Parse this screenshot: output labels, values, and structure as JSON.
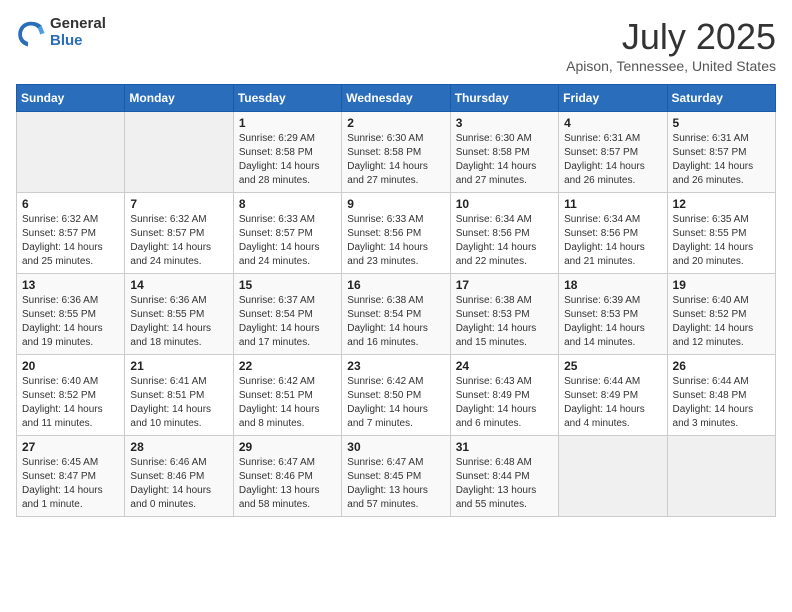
{
  "header": {
    "logo_general": "General",
    "logo_blue": "Blue",
    "month": "July 2025",
    "location": "Apison, Tennessee, United States"
  },
  "days_of_week": [
    "Sunday",
    "Monday",
    "Tuesday",
    "Wednesday",
    "Thursday",
    "Friday",
    "Saturday"
  ],
  "weeks": [
    [
      {
        "day": "",
        "sunrise": "",
        "sunset": "",
        "daylight": ""
      },
      {
        "day": "",
        "sunrise": "",
        "sunset": "",
        "daylight": ""
      },
      {
        "day": "1",
        "sunrise": "Sunrise: 6:29 AM",
        "sunset": "Sunset: 8:58 PM",
        "daylight": "Daylight: 14 hours and 28 minutes."
      },
      {
        "day": "2",
        "sunrise": "Sunrise: 6:30 AM",
        "sunset": "Sunset: 8:58 PM",
        "daylight": "Daylight: 14 hours and 27 minutes."
      },
      {
        "day": "3",
        "sunrise": "Sunrise: 6:30 AM",
        "sunset": "Sunset: 8:58 PM",
        "daylight": "Daylight: 14 hours and 27 minutes."
      },
      {
        "day": "4",
        "sunrise": "Sunrise: 6:31 AM",
        "sunset": "Sunset: 8:57 PM",
        "daylight": "Daylight: 14 hours and 26 minutes."
      },
      {
        "day": "5",
        "sunrise": "Sunrise: 6:31 AM",
        "sunset": "Sunset: 8:57 PM",
        "daylight": "Daylight: 14 hours and 26 minutes."
      }
    ],
    [
      {
        "day": "6",
        "sunrise": "Sunrise: 6:32 AM",
        "sunset": "Sunset: 8:57 PM",
        "daylight": "Daylight: 14 hours and 25 minutes."
      },
      {
        "day": "7",
        "sunrise": "Sunrise: 6:32 AM",
        "sunset": "Sunset: 8:57 PM",
        "daylight": "Daylight: 14 hours and 24 minutes."
      },
      {
        "day": "8",
        "sunrise": "Sunrise: 6:33 AM",
        "sunset": "Sunset: 8:57 PM",
        "daylight": "Daylight: 14 hours and 24 minutes."
      },
      {
        "day": "9",
        "sunrise": "Sunrise: 6:33 AM",
        "sunset": "Sunset: 8:56 PM",
        "daylight": "Daylight: 14 hours and 23 minutes."
      },
      {
        "day": "10",
        "sunrise": "Sunrise: 6:34 AM",
        "sunset": "Sunset: 8:56 PM",
        "daylight": "Daylight: 14 hours and 22 minutes."
      },
      {
        "day": "11",
        "sunrise": "Sunrise: 6:34 AM",
        "sunset": "Sunset: 8:56 PM",
        "daylight": "Daylight: 14 hours and 21 minutes."
      },
      {
        "day": "12",
        "sunrise": "Sunrise: 6:35 AM",
        "sunset": "Sunset: 8:55 PM",
        "daylight": "Daylight: 14 hours and 20 minutes."
      }
    ],
    [
      {
        "day": "13",
        "sunrise": "Sunrise: 6:36 AM",
        "sunset": "Sunset: 8:55 PM",
        "daylight": "Daylight: 14 hours and 19 minutes."
      },
      {
        "day": "14",
        "sunrise": "Sunrise: 6:36 AM",
        "sunset": "Sunset: 8:55 PM",
        "daylight": "Daylight: 14 hours and 18 minutes."
      },
      {
        "day": "15",
        "sunrise": "Sunrise: 6:37 AM",
        "sunset": "Sunset: 8:54 PM",
        "daylight": "Daylight: 14 hours and 17 minutes."
      },
      {
        "day": "16",
        "sunrise": "Sunrise: 6:38 AM",
        "sunset": "Sunset: 8:54 PM",
        "daylight": "Daylight: 14 hours and 16 minutes."
      },
      {
        "day": "17",
        "sunrise": "Sunrise: 6:38 AM",
        "sunset": "Sunset: 8:53 PM",
        "daylight": "Daylight: 14 hours and 15 minutes."
      },
      {
        "day": "18",
        "sunrise": "Sunrise: 6:39 AM",
        "sunset": "Sunset: 8:53 PM",
        "daylight": "Daylight: 14 hours and 14 minutes."
      },
      {
        "day": "19",
        "sunrise": "Sunrise: 6:40 AM",
        "sunset": "Sunset: 8:52 PM",
        "daylight": "Daylight: 14 hours and 12 minutes."
      }
    ],
    [
      {
        "day": "20",
        "sunrise": "Sunrise: 6:40 AM",
        "sunset": "Sunset: 8:52 PM",
        "daylight": "Daylight: 14 hours and 11 minutes."
      },
      {
        "day": "21",
        "sunrise": "Sunrise: 6:41 AM",
        "sunset": "Sunset: 8:51 PM",
        "daylight": "Daylight: 14 hours and 10 minutes."
      },
      {
        "day": "22",
        "sunrise": "Sunrise: 6:42 AM",
        "sunset": "Sunset: 8:51 PM",
        "daylight": "Daylight: 14 hours and 8 minutes."
      },
      {
        "day": "23",
        "sunrise": "Sunrise: 6:42 AM",
        "sunset": "Sunset: 8:50 PM",
        "daylight": "Daylight: 14 hours and 7 minutes."
      },
      {
        "day": "24",
        "sunrise": "Sunrise: 6:43 AM",
        "sunset": "Sunset: 8:49 PM",
        "daylight": "Daylight: 14 hours and 6 minutes."
      },
      {
        "day": "25",
        "sunrise": "Sunrise: 6:44 AM",
        "sunset": "Sunset: 8:49 PM",
        "daylight": "Daylight: 14 hours and 4 minutes."
      },
      {
        "day": "26",
        "sunrise": "Sunrise: 6:44 AM",
        "sunset": "Sunset: 8:48 PM",
        "daylight": "Daylight: 14 hours and 3 minutes."
      }
    ],
    [
      {
        "day": "27",
        "sunrise": "Sunrise: 6:45 AM",
        "sunset": "Sunset: 8:47 PM",
        "daylight": "Daylight: 14 hours and 1 minute."
      },
      {
        "day": "28",
        "sunrise": "Sunrise: 6:46 AM",
        "sunset": "Sunset: 8:46 PM",
        "daylight": "Daylight: 14 hours and 0 minutes."
      },
      {
        "day": "29",
        "sunrise": "Sunrise: 6:47 AM",
        "sunset": "Sunset: 8:46 PM",
        "daylight": "Daylight: 13 hours and 58 minutes."
      },
      {
        "day": "30",
        "sunrise": "Sunrise: 6:47 AM",
        "sunset": "Sunset: 8:45 PM",
        "daylight": "Daylight: 13 hours and 57 minutes."
      },
      {
        "day": "31",
        "sunrise": "Sunrise: 6:48 AM",
        "sunset": "Sunset: 8:44 PM",
        "daylight": "Daylight: 13 hours and 55 minutes."
      },
      {
        "day": "",
        "sunrise": "",
        "sunset": "",
        "daylight": ""
      },
      {
        "day": "",
        "sunrise": "",
        "sunset": "",
        "daylight": ""
      }
    ]
  ]
}
